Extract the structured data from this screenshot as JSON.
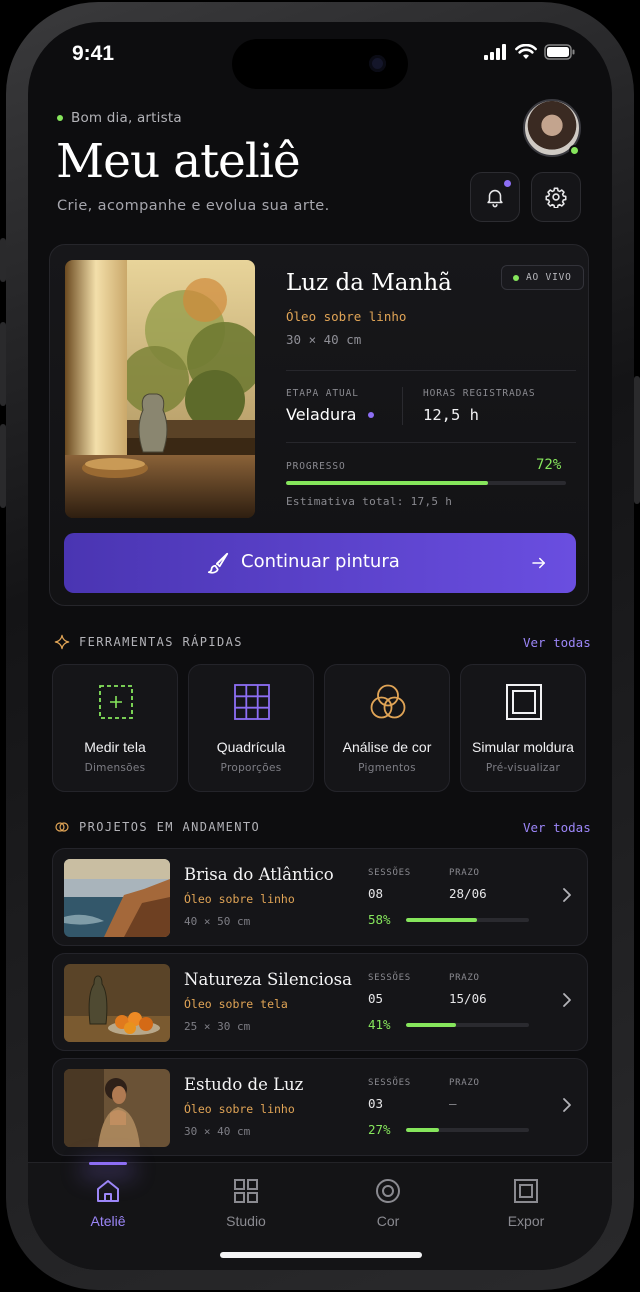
{
  "status": {
    "time": "9:41"
  },
  "header": {
    "greeting": "Bom dia, artista",
    "title": "Meu ateliê",
    "subtitle": "Crie, acompanhe e evolua sua arte."
  },
  "hero": {
    "title": "Luz da Manhã",
    "badge": "AO VIVO",
    "medium": "Óleo sobre linho",
    "size": "30 × 40 cm",
    "stage_label": "ETAPA ATUAL",
    "stage_value": "Veladura",
    "hours_label": "HORAS REGISTRADAS",
    "hours_value": "12,5 h",
    "progress_label": "PROGRESSO",
    "progress_value": "72%",
    "progress": 0.72,
    "estimate": "Estimativa total: 17,5 h",
    "cta": "Continuar pintura"
  },
  "tools": {
    "heading": "FERRAMENTAS RÁPIDAS",
    "see_all": "Ver todas",
    "items": [
      {
        "title": "Medir tela",
        "subtitle": "Dimensões",
        "icon": "measure-canvas-icon"
      },
      {
        "title": "Quadrícula",
        "subtitle": "Proporções",
        "icon": "grid-icon"
      },
      {
        "title": "Análise de cor",
        "subtitle": "Pigmentos",
        "icon": "color-circles-icon"
      },
      {
        "title": "Simular moldura",
        "subtitle": "Pré-visualizar",
        "icon": "frame-icon"
      }
    ]
  },
  "projects": {
    "heading": "PROJETOS EM ANDAMENTO",
    "see_all": "Ver todas",
    "sessions_label": "SESSÕES",
    "deadline_label": "PRAZO",
    "items": [
      {
        "title": "Brisa do Atlântico",
        "medium": "Óleo sobre linho",
        "size": "40 × 50 cm",
        "sessions": "08",
        "deadline": "28/06",
        "progress_text": "58%",
        "progress": 0.58
      },
      {
        "title": "Natureza Silenciosa",
        "medium": "Óleo sobre tela",
        "size": "25 × 30 cm",
        "sessions": "05",
        "deadline": "15/06",
        "progress_text": "41%",
        "progress": 0.41
      },
      {
        "title": "Estudo de Luz",
        "medium": "Óleo sobre linho",
        "size": "30 × 40 cm",
        "sessions": "03",
        "deadline": "—",
        "progress_text": "27%",
        "progress": 0.27
      }
    ]
  },
  "tabbar": {
    "tabs": [
      {
        "label": "Ateliê",
        "icon": "home-icon",
        "active": true
      },
      {
        "label": "Studio",
        "icon": "grid-squares-icon",
        "active": false
      },
      {
        "label": "Cor",
        "icon": "color-target-icon",
        "active": false
      },
      {
        "label": "Expor",
        "icon": "frame-icon",
        "active": false
      }
    ]
  },
  "colors": {
    "accent": "#8d6ef4",
    "progress": "#86e65c",
    "medium": "#e0a456",
    "background": "#0d0d0f"
  }
}
